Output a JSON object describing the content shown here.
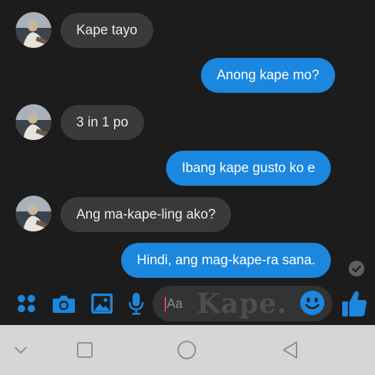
{
  "messages": [
    {
      "side": "in",
      "text": "Kape tayo"
    },
    {
      "side": "out",
      "text": "Anong kape mo?"
    },
    {
      "side": "in",
      "text": "3 in 1 po"
    },
    {
      "side": "out",
      "text": "Ibang kape gusto ko e"
    },
    {
      "side": "in",
      "text": "Ang ma-kape-ling ako?"
    },
    {
      "side": "out",
      "text": "Hindi, ang mag-kape-ra sana."
    }
  ],
  "composer": {
    "placeholder": "Aa",
    "watermark": "Kape."
  },
  "icons": {
    "apps": "apps-grid-icon",
    "camera": "camera-icon",
    "gallery": "gallery-icon",
    "mic": "microphone-icon",
    "emoji": "emoji-icon",
    "like": "thumbs-up-icon",
    "seen": "seen-check-icon",
    "nav_back": "chevron-down-icon",
    "nav_recent": "square-icon",
    "nav_home": "circle-icon",
    "nav_prev": "triangle-back-icon"
  },
  "colors": {
    "outgoing_bubble": "#1b87df",
    "incoming_bubble": "#3a3a3a",
    "accent": "#1b87df",
    "background": "#1c1c1c",
    "navbar": "#d6d6d6"
  }
}
